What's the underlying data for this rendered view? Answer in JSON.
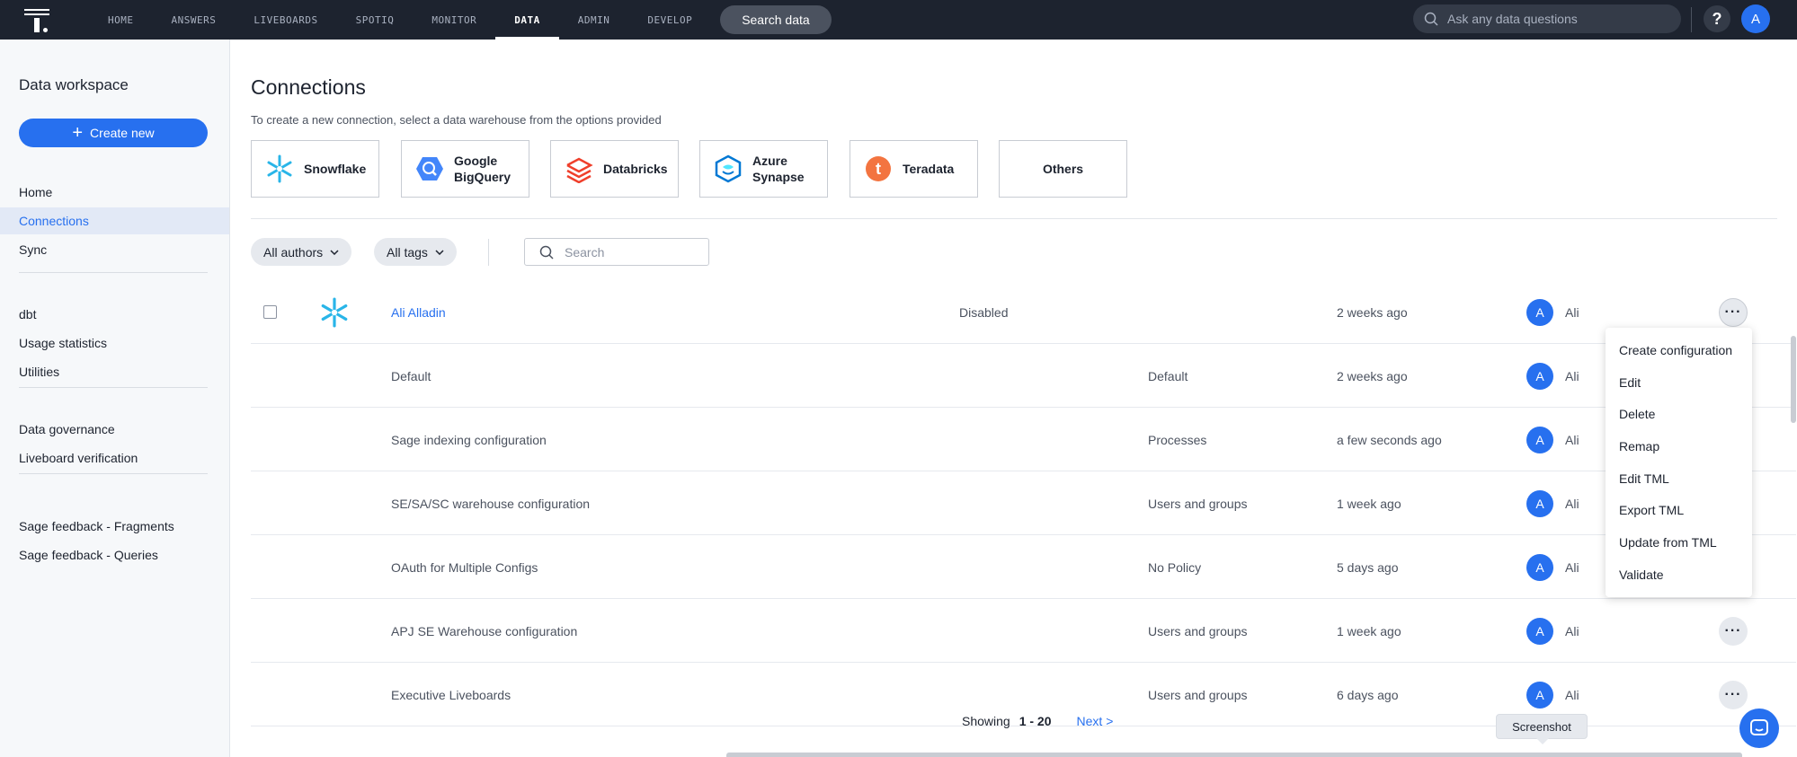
{
  "topnav": {
    "items": [
      "HOME",
      "ANSWERS",
      "LIVEBOARDS",
      "SPOTIQ",
      "MONITOR",
      "DATA",
      "ADMIN",
      "DEVELOP"
    ],
    "active": "DATA",
    "search_data_label": "Search data",
    "ask_placeholder": "Ask any data questions",
    "help_label": "?",
    "user_initial": "A"
  },
  "sidebar": {
    "title": "Data workspace",
    "create_label": "Create new",
    "groups": [
      [
        "Home",
        "Connections",
        "Sync"
      ],
      [
        "dbt",
        "Usage statistics",
        "Utilities"
      ],
      [
        "Data governance",
        "Liveboard verification"
      ],
      [
        "Sage feedback - Fragments",
        "Sage feedback - Queries"
      ]
    ],
    "active": "Connections"
  },
  "main": {
    "title": "Connections",
    "subtitle": "To create a new connection, select a data warehouse from the options provided",
    "warehouses": [
      {
        "label": "Snowflake",
        "icon": "snowflake-icon",
        "color": "#29b5e8"
      },
      {
        "label": "Google BigQuery",
        "icon": "bigquery-icon",
        "color": "#4386fa"
      },
      {
        "label": "Databricks",
        "icon": "databricks-icon",
        "color": "#ef3f2b"
      },
      {
        "label": "Azure Synapse",
        "icon": "azure-synapse-icon",
        "color": "#0078d4"
      },
      {
        "label": "Teradata",
        "icon": "teradata-icon",
        "color": "#f37440"
      },
      {
        "label": "Others",
        "icon": "",
        "color": ""
      }
    ],
    "filters": {
      "authors_label": "All authors",
      "tags_label": "All tags",
      "search_placeholder": "Search"
    },
    "rows": [
      {
        "name": "Ali Alladin",
        "status": "Disabled",
        "policy": "",
        "time": "2 weeks ago",
        "initial": "A",
        "author": "Ali",
        "is_connection": true,
        "show_more": true
      },
      {
        "name": "Default",
        "status": "",
        "policy": "Default",
        "time": "2 weeks ago",
        "initial": "A",
        "author": "Ali",
        "is_connection": false,
        "show_more": false
      },
      {
        "name": "Sage indexing configuration",
        "status": "",
        "policy": "Processes",
        "time": "a few seconds ago",
        "initial": "A",
        "author": "Ali",
        "is_connection": false,
        "show_more": false
      },
      {
        "name": "SE/SA/SC warehouse configuration",
        "status": "",
        "policy": "Users and groups",
        "time": "1 week ago",
        "initial": "A",
        "author": "Ali",
        "is_connection": false,
        "show_more": false
      },
      {
        "name": "OAuth for Multiple Configs",
        "status": "",
        "policy": "No Policy",
        "time": "5 days ago",
        "initial": "A",
        "author": "Ali",
        "is_connection": false,
        "show_more": false
      },
      {
        "name": "APJ SE Warehouse configuration",
        "status": "",
        "policy": "Users and groups",
        "time": "1 week ago",
        "initial": "A",
        "author": "Ali",
        "is_connection": false,
        "show_more": true
      },
      {
        "name": "Executive Liveboards",
        "status": "",
        "policy": "Users and groups",
        "time": "6 days ago",
        "initial": "A",
        "author": "Ali",
        "is_connection": false,
        "show_more": true
      }
    ],
    "menu": [
      "Create configuration",
      "Edit",
      "Delete",
      "Remap",
      "Edit TML",
      "Export TML",
      "Update from TML",
      "Validate"
    ],
    "pager": {
      "showing": "Showing",
      "range": "1 - 20",
      "next": "Next >"
    },
    "tooltip": "Screenshot"
  },
  "colors": {
    "accent": "#2770ef",
    "nav_bg": "#1d232f",
    "sidebar_bg": "#f6f8fa"
  }
}
